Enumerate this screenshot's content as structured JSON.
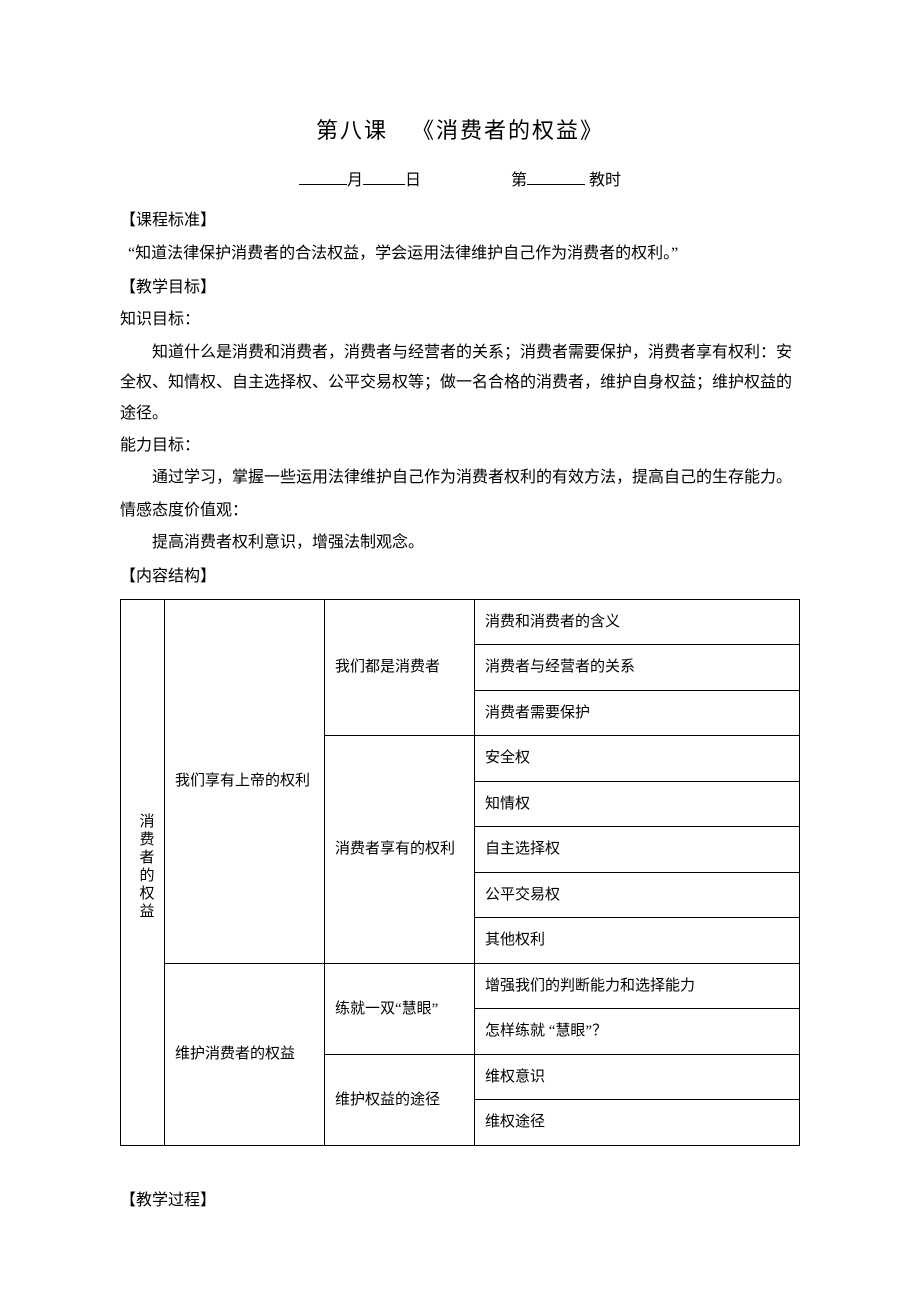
{
  "title": "第八课 《消费者的权益》",
  "date_line": {
    "month_label": "月",
    "day_label": "日",
    "ordinal_prefix": "第",
    "period_label": "教时"
  },
  "sections": {
    "standard_head": "【课程标准】",
    "standard_body": "“知道法律保护消费者的合法权益，学会运用法律维护自己作为消费者的权利。”",
    "goal_head": "【教学目标】",
    "knowledge_label": "知识目标：",
    "knowledge_body": "知道什么是消费和消费者，消费者与经营者的关系；消费者需要保护，消费者享有权利：安全权、知情权、自主选择权、公平交易权等；做一名合格的消费者，维护自身权益；维护权益的途径。",
    "ability_label": "能力目标：",
    "ability_body": "通过学习，掌握一些运用法律维护自己作为消费者权利的有效方法，提高自己的生存能力。",
    "attitude_label": "情感态度价值观：",
    "attitude_body": "提高消费者权利意识，增强法制观念。",
    "structure_head": "【内容结构】",
    "process_head": "【教学过程】"
  },
  "table": {
    "root": "消费者的权益",
    "row1": {
      "col2": "我们享有上帝的权利",
      "a": {
        "col3": "我们都是消费者",
        "items": [
          "消费和消费者的含义",
          "消费者与经营者的关系",
          "消费者需要保护"
        ]
      },
      "b": {
        "col3": "消费者享有的权利",
        "items": [
          "安全权",
          "知情权",
          "自主选择权",
          "公平交易权",
          "其他权利"
        ]
      }
    },
    "row2": {
      "col2": "维护消费者的权益",
      "a": {
        "col3": "练就一双“慧眼”",
        "items": [
          "增强我们的判断能力和选择能力",
          "怎样练就 “慧眼”？"
        ]
      },
      "b": {
        "col3": "维护权益的途径",
        "items": [
          "维权意识",
          "维权途径"
        ]
      }
    }
  }
}
